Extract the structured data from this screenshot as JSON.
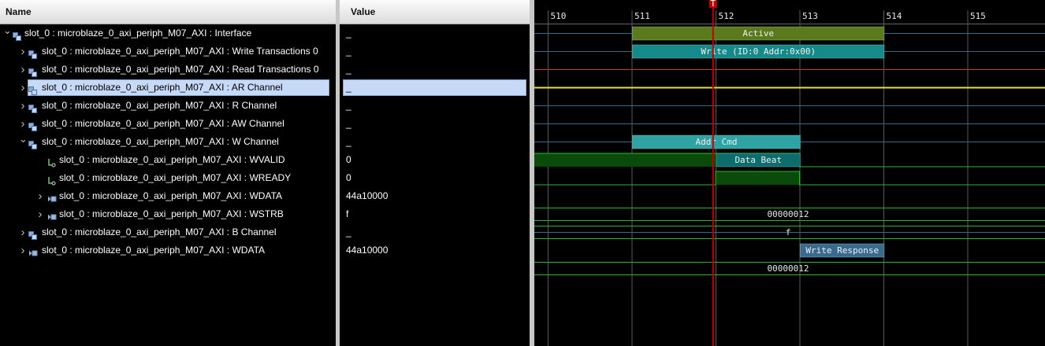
{
  "headers": {
    "name": "Name",
    "value": "Value"
  },
  "rows": [
    {
      "label": "slot_0 : microblaze_0_axi_periph_M07_AXI : Interface",
      "value": "_",
      "indent": 0,
      "expander": "open",
      "icon": "interface"
    },
    {
      "label": "slot_0 : microblaze_0_axi_periph_M07_AXI : Write Transactions 0",
      "value": "_",
      "indent": 1,
      "expander": "closed",
      "icon": "interface"
    },
    {
      "label": "slot_0 : microblaze_0_axi_periph_M07_AXI : Read Transactions 0",
      "value": "_",
      "indent": 1,
      "expander": "closed",
      "icon": "interface"
    },
    {
      "label": "slot_0 : microblaze_0_axi_periph_M07_AXI : AR Channel",
      "value": "_",
      "indent": 1,
      "expander": "closed",
      "icon": "interface",
      "selected": true
    },
    {
      "label": "slot_0 : microblaze_0_axi_periph_M07_AXI : R Channel",
      "value": "_",
      "indent": 1,
      "expander": "closed",
      "icon": "interface"
    },
    {
      "label": "slot_0 : microblaze_0_axi_periph_M07_AXI : AW Channel",
      "value": "_",
      "indent": 1,
      "expander": "closed",
      "icon": "interface"
    },
    {
      "label": "slot_0 : microblaze_0_axi_periph_M07_AXI : W Channel",
      "value": "_",
      "indent": 1,
      "expander": "open",
      "icon": "interface"
    },
    {
      "label": "slot_0 : microblaze_0_axi_periph_M07_AXI : WVALID",
      "value": "0",
      "indent": 2,
      "expander": "none",
      "icon": "bit"
    },
    {
      "label": "slot_0 : microblaze_0_axi_periph_M07_AXI : WREADY",
      "value": "0",
      "indent": 2,
      "expander": "none",
      "icon": "bit"
    },
    {
      "label": "slot_0 : microblaze_0_axi_periph_M07_AXI : WDATA",
      "value": "44a10000",
      "indent": 2,
      "expander": "closed",
      "icon": "bus"
    },
    {
      "label": "slot_0 : microblaze_0_axi_periph_M07_AXI : WSTRB",
      "value": "f",
      "indent": 2,
      "expander": "closed",
      "icon": "bus"
    },
    {
      "label": "slot_0 : microblaze_0_axi_periph_M07_AXI : B Channel",
      "value": "_",
      "indent": 1,
      "expander": "closed",
      "icon": "interface"
    },
    {
      "label": "slot_0 : microblaze_0_axi_periph_M07_AXI : WDATA",
      "value": "44a10000",
      "indent": 1,
      "expander": "closed",
      "icon": "bus"
    }
  ],
  "timeline": {
    "ticks": [
      "510",
      "511",
      "512",
      "513",
      "514",
      "515"
    ],
    "t0": 510,
    "t1": 515.4,
    "cursor": 511.97,
    "cursor_label": "T",
    "bands": [
      {
        "row": 0,
        "from": 511,
        "to": 514,
        "text": "Active",
        "color": "#5a7a1c"
      },
      {
        "row": 1,
        "from": 511,
        "to": 514,
        "text": "Write (ID:0 Addr:0x00)",
        "color": "#168a8a"
      },
      {
        "row": 6,
        "from": 511,
        "to": 513,
        "text": "Addr Cmd",
        "color": "#2fa3a3"
      },
      {
        "row": 7,
        "from": 512,
        "to": 513,
        "text": "Data Beat",
        "color": "#0d6d6d"
      },
      {
        "row": 12,
        "from": 513,
        "to": 514,
        "text": "Write Response",
        "color": "#3b6a8f"
      }
    ],
    "bus_values": [
      {
        "row": 10,
        "text": "00000012"
      },
      {
        "row": 11,
        "text": "f"
      },
      {
        "row": 13,
        "text": "00000012"
      }
    ]
  },
  "colors": {
    "cursor": "#c20000",
    "signal_high_fill": "#0a4a0a",
    "signal_line": "#2fb52f",
    "selected_line": "#e8e040"
  }
}
